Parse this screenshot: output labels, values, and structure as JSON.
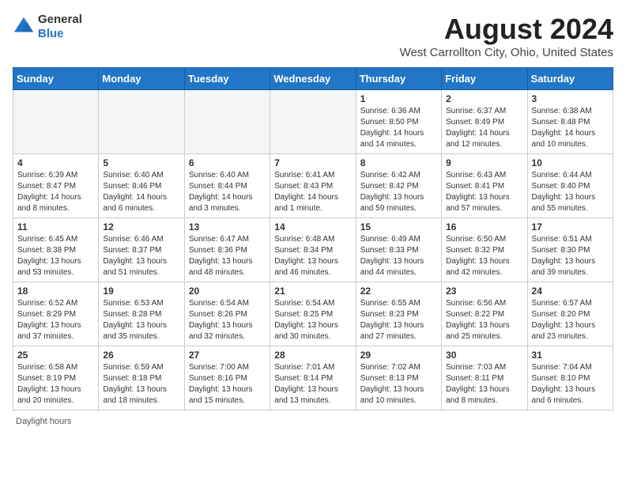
{
  "header": {
    "logo_general": "General",
    "logo_blue": "Blue",
    "month_title": "August 2024",
    "location": "West Carrollton City, Ohio, United States"
  },
  "days_of_week": [
    "Sunday",
    "Monday",
    "Tuesday",
    "Wednesday",
    "Thursday",
    "Friday",
    "Saturday"
  ],
  "weeks": [
    [
      {
        "day": "",
        "content": ""
      },
      {
        "day": "",
        "content": ""
      },
      {
        "day": "",
        "content": ""
      },
      {
        "day": "",
        "content": ""
      },
      {
        "day": "1",
        "content": "Sunrise: 6:36 AM\nSunset: 8:50 PM\nDaylight: 14 hours and 14 minutes."
      },
      {
        "day": "2",
        "content": "Sunrise: 6:37 AM\nSunset: 8:49 PM\nDaylight: 14 hours and 12 minutes."
      },
      {
        "day": "3",
        "content": "Sunrise: 6:38 AM\nSunset: 8:48 PM\nDaylight: 14 hours and 10 minutes."
      }
    ],
    [
      {
        "day": "4",
        "content": "Sunrise: 6:39 AM\nSunset: 8:47 PM\nDaylight: 14 hours and 8 minutes."
      },
      {
        "day": "5",
        "content": "Sunrise: 6:40 AM\nSunset: 8:46 PM\nDaylight: 14 hours and 6 minutes."
      },
      {
        "day": "6",
        "content": "Sunrise: 6:40 AM\nSunset: 8:44 PM\nDaylight: 14 hours and 3 minutes."
      },
      {
        "day": "7",
        "content": "Sunrise: 6:41 AM\nSunset: 8:43 PM\nDaylight: 14 hours and 1 minute."
      },
      {
        "day": "8",
        "content": "Sunrise: 6:42 AM\nSunset: 8:42 PM\nDaylight: 13 hours and 59 minutes."
      },
      {
        "day": "9",
        "content": "Sunrise: 6:43 AM\nSunset: 8:41 PM\nDaylight: 13 hours and 57 minutes."
      },
      {
        "day": "10",
        "content": "Sunrise: 6:44 AM\nSunset: 8:40 PM\nDaylight: 13 hours and 55 minutes."
      }
    ],
    [
      {
        "day": "11",
        "content": "Sunrise: 6:45 AM\nSunset: 8:38 PM\nDaylight: 13 hours and 53 minutes."
      },
      {
        "day": "12",
        "content": "Sunrise: 6:46 AM\nSunset: 8:37 PM\nDaylight: 13 hours and 51 minutes."
      },
      {
        "day": "13",
        "content": "Sunrise: 6:47 AM\nSunset: 8:36 PM\nDaylight: 13 hours and 48 minutes."
      },
      {
        "day": "14",
        "content": "Sunrise: 6:48 AM\nSunset: 8:34 PM\nDaylight: 13 hours and 46 minutes."
      },
      {
        "day": "15",
        "content": "Sunrise: 6:49 AM\nSunset: 8:33 PM\nDaylight: 13 hours and 44 minutes."
      },
      {
        "day": "16",
        "content": "Sunrise: 6:50 AM\nSunset: 8:32 PM\nDaylight: 13 hours and 42 minutes."
      },
      {
        "day": "17",
        "content": "Sunrise: 6:51 AM\nSunset: 8:30 PM\nDaylight: 13 hours and 39 minutes."
      }
    ],
    [
      {
        "day": "18",
        "content": "Sunrise: 6:52 AM\nSunset: 8:29 PM\nDaylight: 13 hours and 37 minutes."
      },
      {
        "day": "19",
        "content": "Sunrise: 6:53 AM\nSunset: 8:28 PM\nDaylight: 13 hours and 35 minutes."
      },
      {
        "day": "20",
        "content": "Sunrise: 6:54 AM\nSunset: 8:26 PM\nDaylight: 13 hours and 32 minutes."
      },
      {
        "day": "21",
        "content": "Sunrise: 6:54 AM\nSunset: 8:25 PM\nDaylight: 13 hours and 30 minutes."
      },
      {
        "day": "22",
        "content": "Sunrise: 6:55 AM\nSunset: 8:23 PM\nDaylight: 13 hours and 27 minutes."
      },
      {
        "day": "23",
        "content": "Sunrise: 6:56 AM\nSunset: 8:22 PM\nDaylight: 13 hours and 25 minutes."
      },
      {
        "day": "24",
        "content": "Sunrise: 6:57 AM\nSunset: 8:20 PM\nDaylight: 13 hours and 23 minutes."
      }
    ],
    [
      {
        "day": "25",
        "content": "Sunrise: 6:58 AM\nSunset: 8:19 PM\nDaylight: 13 hours and 20 minutes."
      },
      {
        "day": "26",
        "content": "Sunrise: 6:59 AM\nSunset: 8:18 PM\nDaylight: 13 hours and 18 minutes."
      },
      {
        "day": "27",
        "content": "Sunrise: 7:00 AM\nSunset: 8:16 PM\nDaylight: 13 hours and 15 minutes."
      },
      {
        "day": "28",
        "content": "Sunrise: 7:01 AM\nSunset: 8:14 PM\nDaylight: 13 hours and 13 minutes."
      },
      {
        "day": "29",
        "content": "Sunrise: 7:02 AM\nSunset: 8:13 PM\nDaylight: 13 hours and 10 minutes."
      },
      {
        "day": "30",
        "content": "Sunrise: 7:03 AM\nSunset: 8:11 PM\nDaylight: 13 hours and 8 minutes."
      },
      {
        "day": "31",
        "content": "Sunrise: 7:04 AM\nSunset: 8:10 PM\nDaylight: 13 hours and 6 minutes."
      }
    ]
  ],
  "footer": {
    "note": "Daylight hours"
  }
}
